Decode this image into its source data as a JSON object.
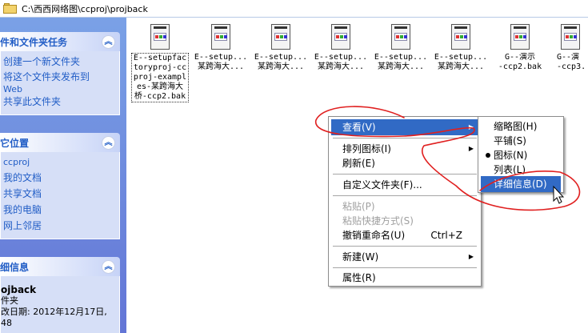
{
  "address_bar": {
    "path": "C:\\西西网络图\\ccproj\\projback"
  },
  "task_pane": {
    "tasks": {
      "title": "件和文件夹任务",
      "links": [
        "创建一个新文件夹",
        "将这个文件夹发布到",
        "Web",
        "共享此文件夹"
      ]
    },
    "other_places": {
      "title": "它位置",
      "links": [
        "ccproj",
        "我的文档",
        "共享文档",
        "我的电脑",
        "网上邻居"
      ]
    },
    "details": {
      "title": "细信息",
      "name": "ojback",
      "type": "件夹",
      "modified": "改日期: 2012年12月17日,",
      "time": "48"
    }
  },
  "files": [
    {
      "label": "E--setupfac\ntoryproj-cc\nproj-exampl\nes-某跨海大\n桥-ccp2.bak",
      "selected": true
    },
    {
      "label": "E--setup...\n某跨海大...",
      "selected": false
    },
    {
      "label": "E--setup...\n某跨海大...",
      "selected": false
    },
    {
      "label": "E--setup...\n某跨海大...",
      "selected": false
    },
    {
      "label": "E--setup...\n某跨海大...",
      "selected": false
    },
    {
      "label": "E--setup...\n某跨海大...",
      "selected": false
    },
    {
      "label": "G--演示\n-ccp2.bak",
      "selected": false
    },
    {
      "label": "G--演\n-ccp3.",
      "selected": false
    }
  ],
  "context_menu": {
    "view": "查看(V)",
    "arrange": "排列图标(I)",
    "refresh": "刷新(E)",
    "customize": "自定义文件夹(F)...",
    "paste": "粘贴(P)",
    "paste_shortcut": "粘贴快捷方式(S)",
    "undo_rename": "撤销重命名(U)",
    "undo_shortcut": "Ctrl+Z",
    "new": "新建(W)",
    "properties": "属性(R)"
  },
  "view_submenu": {
    "thumbnails": "缩略图(H)",
    "tiles": "平铺(S)",
    "icons": "图标(N)",
    "list": "列表(L)",
    "details": "详细信息(D)"
  },
  "colors": {
    "highlight": "#316ac5",
    "link": "#215dc6",
    "annotation": "#e02020"
  }
}
